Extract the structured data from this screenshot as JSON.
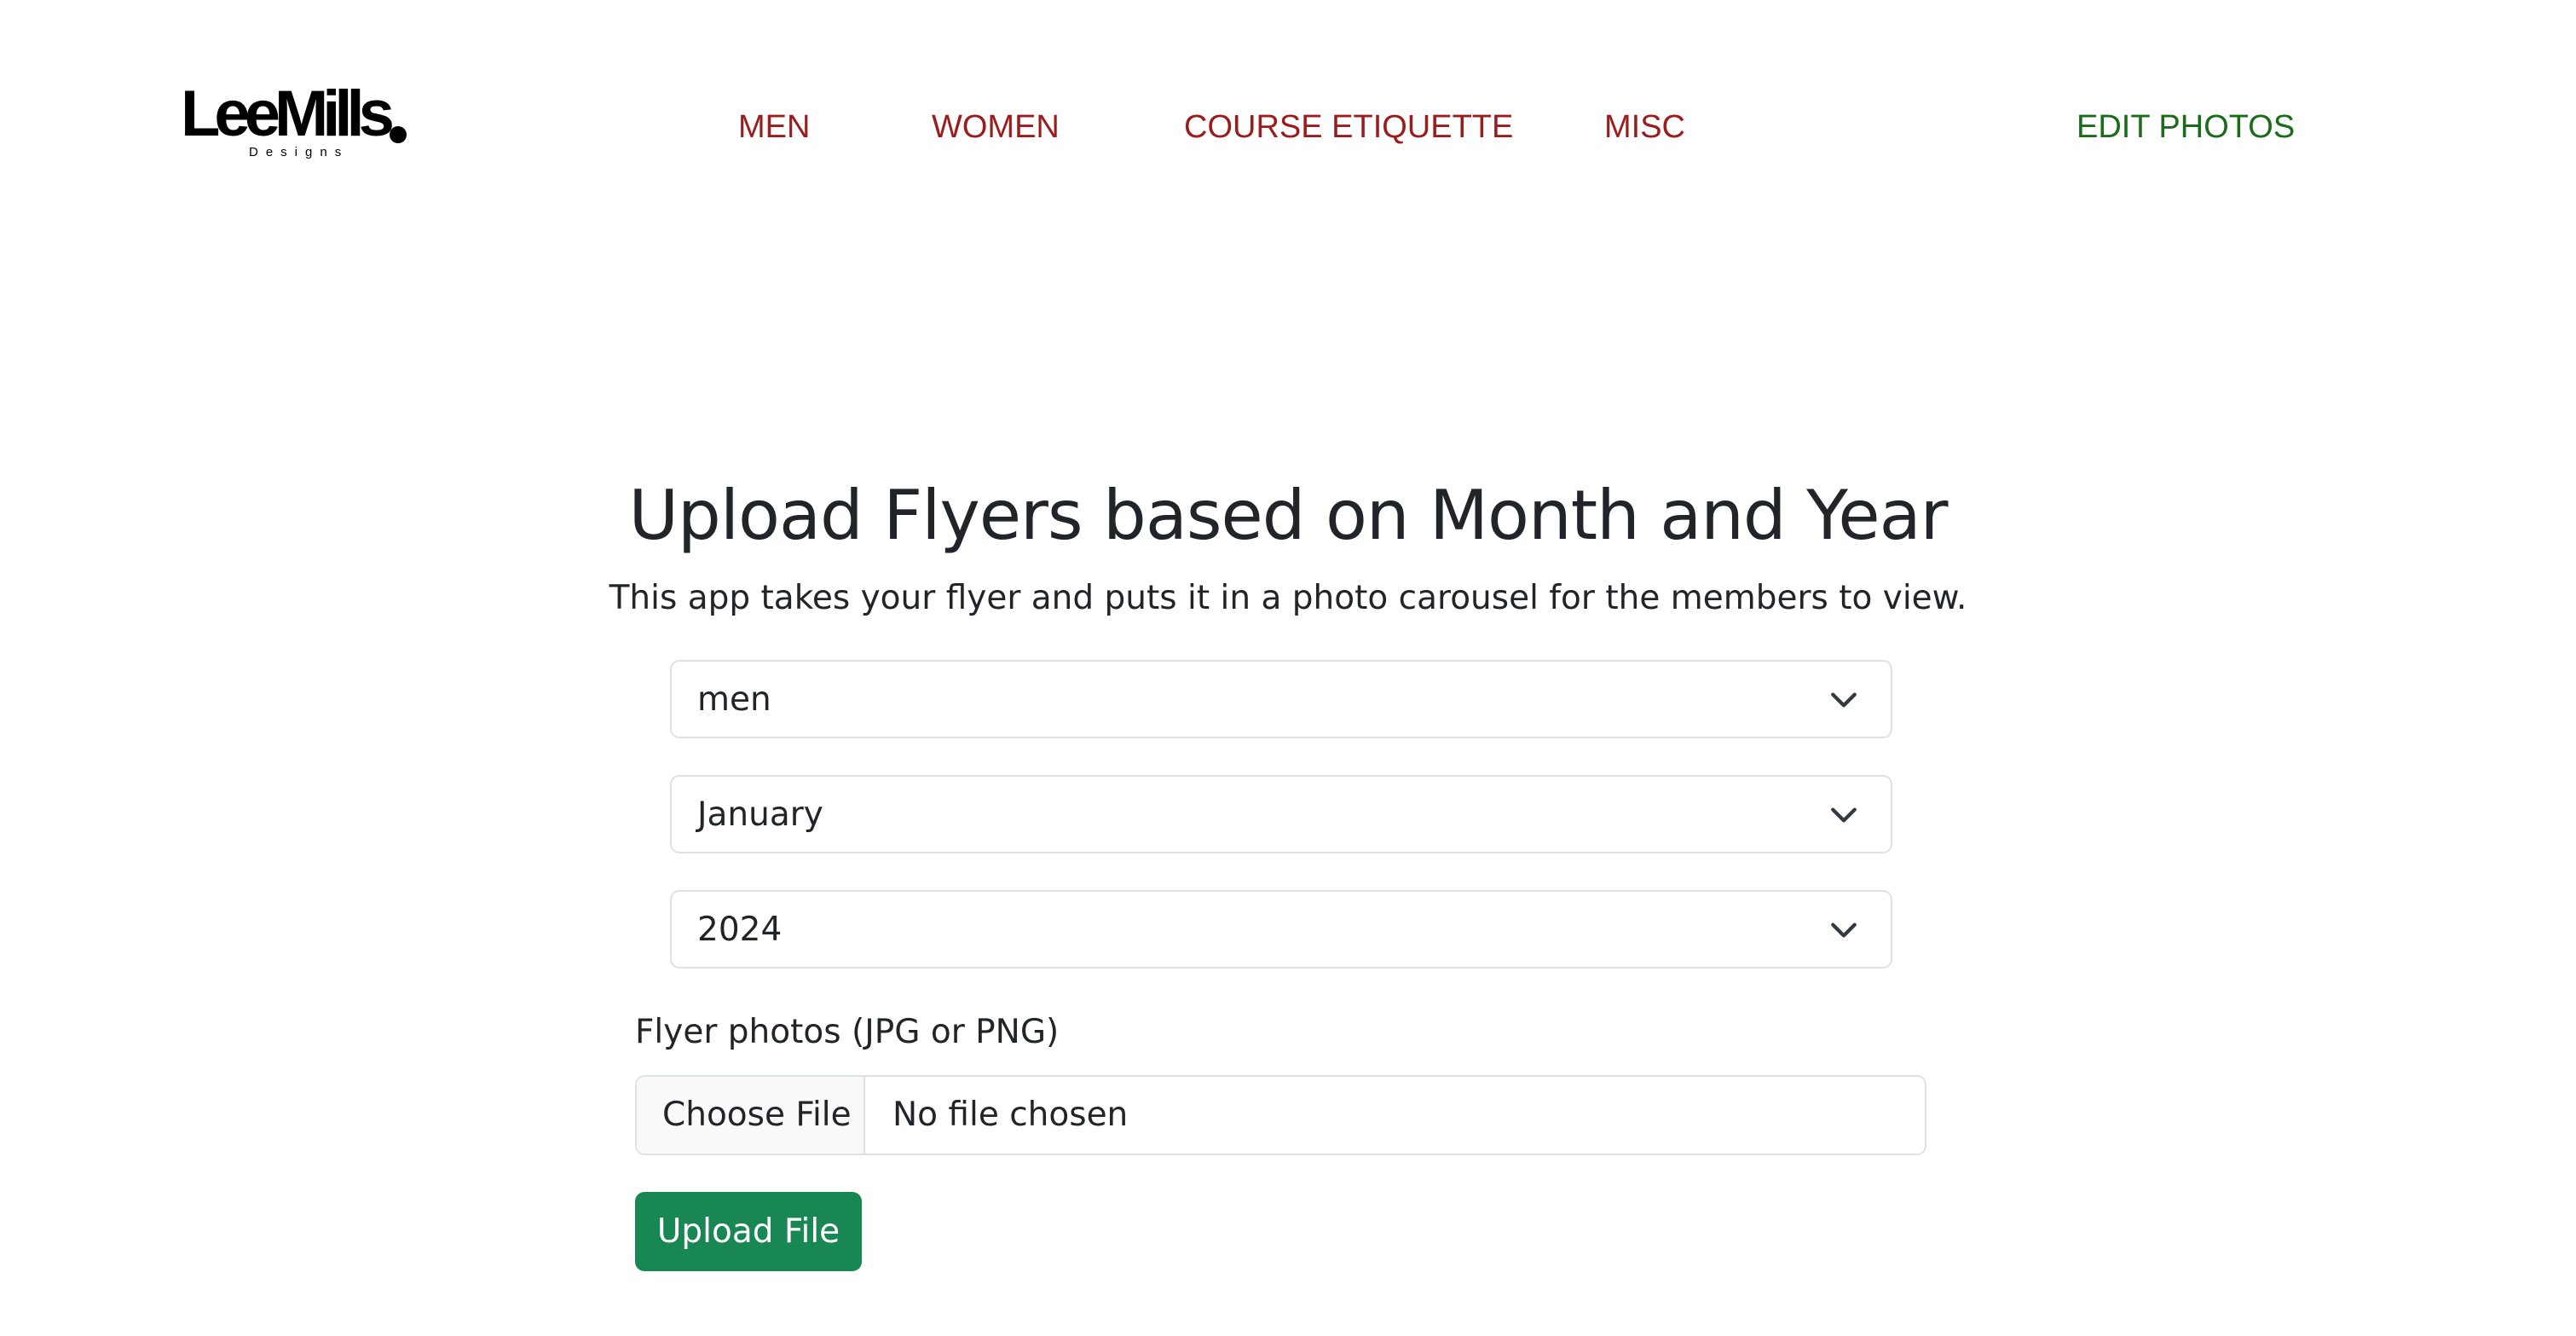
{
  "brand": {
    "logo_text": "LeeMills",
    "logo_subtext": "Designs"
  },
  "nav": {
    "men": "MEN",
    "women": "WOMEN",
    "course_etiquette": "COURSE ETIQUETTE",
    "misc": "MISC",
    "edit_photos": "EDIT PHOTOS"
  },
  "main": {
    "title": "Upload Flyers based on Month and Year",
    "subtitle": "This app takes your flyer and puts it in a photo carousel for the members to view.",
    "gender_select": {
      "value": "men"
    },
    "month_select": {
      "value": "January"
    },
    "year_select": {
      "value": "2024"
    },
    "file_label": "Flyer photos (JPG or PNG)",
    "choose_file_label": "Choose File",
    "file_status": "No file chosen",
    "upload_button": "Upload File"
  },
  "colors": {
    "nav_link": "#9b1c1c",
    "nav_edit": "#1a6b1a",
    "upload_button_bg": "#198754",
    "border": "#dee2e6"
  },
  "icons": {
    "select_chevron": "chevron-down-icon"
  }
}
